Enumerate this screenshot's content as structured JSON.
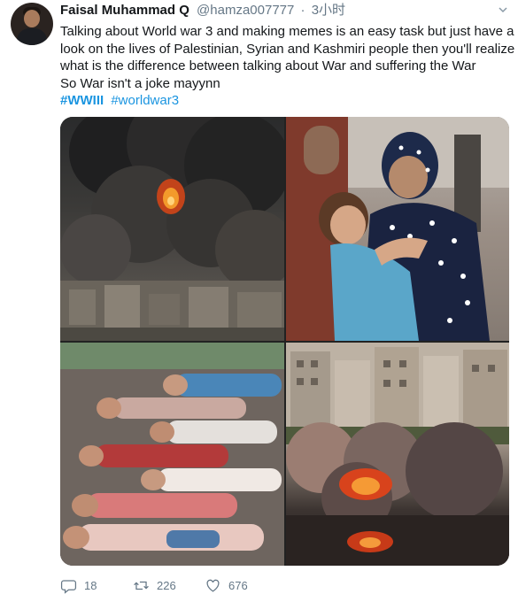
{
  "author": {
    "name": "Faisal Muhammad Q",
    "handle": "@hamza007777",
    "separator": "·",
    "time": "3小时"
  },
  "tweet": {
    "lines": [
      "Talking about World war 3 and making memes is an easy task but just have a",
      "look on the lives of Palestinian, Syrian and Kashmiri people then you'll realize",
      "what is the difference between talking about War and suffering the War",
      "So War isn't a joke mayynn"
    ],
    "hashtags": [
      "#WWIII",
      "#worldwar3"
    ]
  },
  "media": {
    "photos": [
      "photo-explosion-smoke",
      "photo-mother-child",
      "photo-children-lying",
      "photo-city-bombing"
    ]
  },
  "actions": {
    "replies": "18",
    "retweets": "226",
    "likes": "676"
  },
  "icons": [
    "reply-icon",
    "retweet-icon",
    "like-icon",
    "caret-down-icon"
  ],
  "colors": {
    "link": "#1b95e0",
    "muted": "#657786",
    "text": "#14171a"
  }
}
